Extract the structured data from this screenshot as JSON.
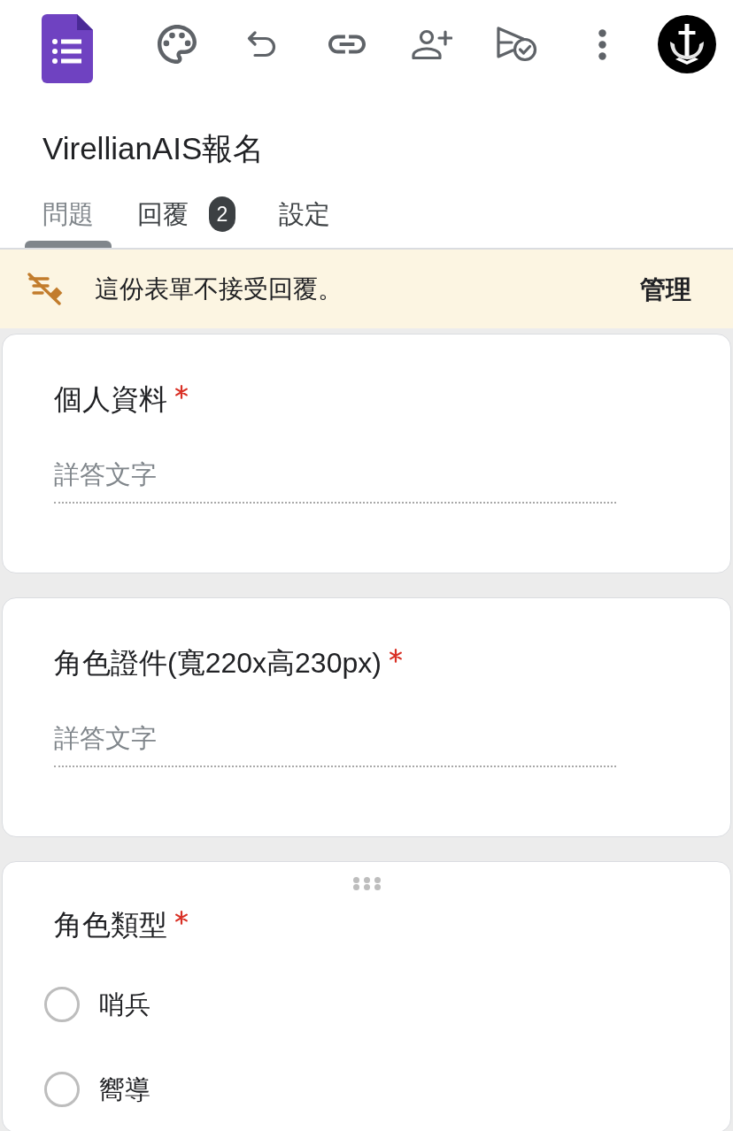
{
  "form": {
    "title": "VirellianAIS報名"
  },
  "tabs": [
    {
      "label": "問題",
      "selected": true
    },
    {
      "label": "回覆",
      "selected": false,
      "badge": "2"
    },
    {
      "label": "設定",
      "selected": false
    }
  ],
  "banner": {
    "message": "這份表單不接受回覆。",
    "action": "管理"
  },
  "questions": [
    {
      "kind": "text",
      "title": "個人資料",
      "required": true,
      "drag_handle": false,
      "placeholder": "詳答文字"
    },
    {
      "kind": "text",
      "title": "角色證件(寬220x高230px)",
      "required": true,
      "drag_handle": false,
      "placeholder": "詳答文字"
    },
    {
      "kind": "choice",
      "title": "角色類型",
      "required": true,
      "drag_handle": true,
      "options": [
        {
          "label": "哨兵",
          "selected": false
        },
        {
          "label": "嚮導",
          "selected": false
        }
      ]
    }
  ]
}
